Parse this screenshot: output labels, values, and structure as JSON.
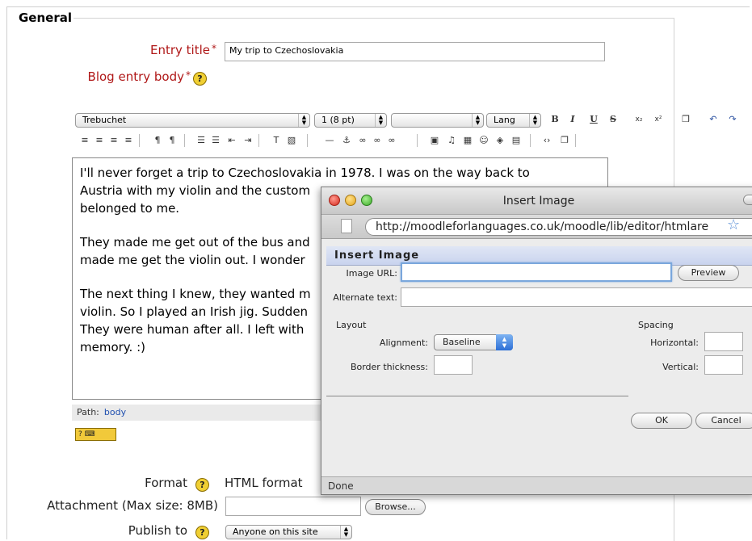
{
  "form": {
    "section_legend": "General",
    "entry_title_label": "Entry title",
    "required_mark": "*",
    "entry_title_value": "My trip to Czechoslovakia",
    "blog_body_label": "Blog entry body",
    "help_glyph": "?",
    "format_label": "Format",
    "format_value": "HTML format",
    "attachment_label": "Attachment (Max size: 8MB)",
    "browse_label": "Browse...",
    "publish_label": "Publish to",
    "publish_value": "Anyone on this site"
  },
  "editor": {
    "font_family": "Trebuchet",
    "font_size": "1 (8 pt)",
    "format_block": "",
    "lang_label": "Lang",
    "toolbar_row1": {
      "bold": "B",
      "italic": "I",
      "underline": "U",
      "strike": "S",
      "subscript": "x₂",
      "superscript": "x²",
      "clean": "❒",
      "undo": "↶",
      "redo": "↷"
    },
    "toolbar_row2": [
      {
        "name": "justify-left-icon",
        "glyph": "≡"
      },
      {
        "name": "justify-center-icon",
        "glyph": "≡"
      },
      {
        "name": "justify-right-icon",
        "glyph": "≡"
      },
      {
        "name": "justify-full-icon",
        "glyph": "≡"
      },
      {
        "name": "ltr-icon",
        "glyph": "¶"
      },
      {
        "name": "rtl-icon",
        "glyph": "¶"
      },
      {
        "name": "ordered-list-icon",
        "glyph": "☰"
      },
      {
        "name": "unordered-list-icon",
        "glyph": "☰"
      },
      {
        "name": "outdent-icon",
        "glyph": "⇤"
      },
      {
        "name": "indent-icon",
        "glyph": "⇥"
      },
      {
        "name": "text-color-icon",
        "glyph": "T"
      },
      {
        "name": "background-color-icon",
        "glyph": "▧"
      },
      {
        "name": "horizontal-rule-icon",
        "glyph": "—"
      },
      {
        "name": "anchor-icon",
        "glyph": "⚓"
      },
      {
        "name": "link-icon",
        "glyph": "∞"
      },
      {
        "name": "unlink-icon",
        "glyph": "∞"
      },
      {
        "name": "nolink-icon",
        "glyph": "∞"
      },
      {
        "name": "insert-image-icon",
        "glyph": "▣"
      },
      {
        "name": "insert-media-icon",
        "glyph": "♫"
      },
      {
        "name": "insert-table-icon",
        "glyph": "▦"
      },
      {
        "name": "insert-smiley-icon",
        "glyph": "☺"
      },
      {
        "name": "insert-object-icon",
        "glyph": "◈"
      },
      {
        "name": "insert-char-icon",
        "glyph": "▤"
      },
      {
        "name": "html-mode-icon",
        "glyph": "‹›"
      },
      {
        "name": "fullscreen-icon",
        "glyph": "❐"
      }
    ],
    "paragraphs": [
      "I'll never forget a trip to Czechoslovakia in 1978. I was on the way back to",
      "Austria with my violin and the custom",
      "belonged to me.",
      "They made me get out of the bus and",
      "made me get the violin out. I wonder",
      "The next thing I knew, they wanted m",
      "violin. So I played an Irish jig. Sudden",
      "They were human after all. I left with",
      "memory. :)"
    ],
    "path_label": "Path:",
    "path_value": "body",
    "keyboard_help": "? ⌨"
  },
  "popup": {
    "window_title": "Insert Image",
    "url": "http://moodleforlanguages.co.uk/moodle/lib/editor/htmlare",
    "dialog_heading": "Insert Image",
    "image_url_label": "Image URL:",
    "image_url_value": "",
    "preview_label": "Preview",
    "alt_text_label": "Alternate text:",
    "alt_text_value": "",
    "layout_heading": "Layout",
    "alignment_label": "Alignment:",
    "alignment_value": "Baseline",
    "border_label": "Border thickness:",
    "border_value": "",
    "spacing_heading": "Spacing",
    "horizontal_label": "Horizontal:",
    "horizontal_value": "",
    "vertical_label": "Vertical:",
    "vertical_value": "",
    "ok_label": "OK",
    "cancel_label": "Cancel",
    "status": "Done"
  },
  "colors": {
    "label_red": "#b01818",
    "help_yellow": "#f0cf33",
    "focus_blue": "#7aa7dc",
    "dialog_header": "#c9d3ee"
  }
}
